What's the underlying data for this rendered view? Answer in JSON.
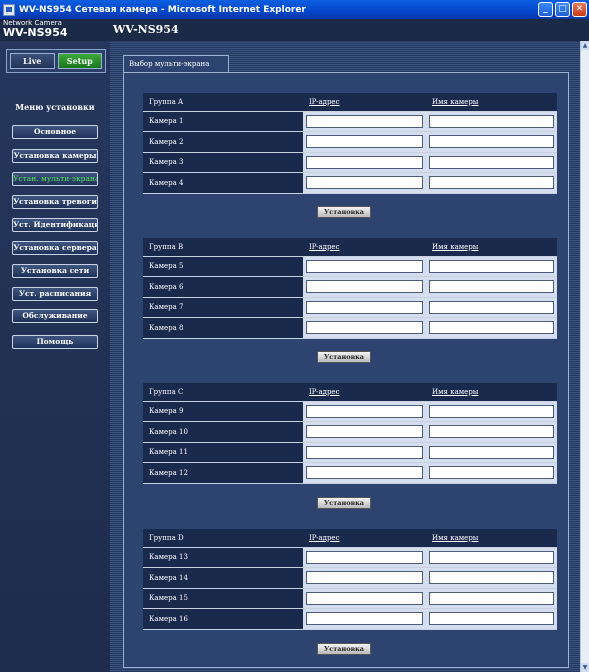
{
  "window": {
    "title": "WV-NS954 Сетевая камера - Microsoft Internet Explorer"
  },
  "header": {
    "brand_small": "Network Camera",
    "brand_model": "WV-NS954",
    "model": "WV-NS954"
  },
  "mode": {
    "live": "Live",
    "setup": "Setup"
  },
  "sidebar": {
    "title": "Меню установки",
    "items": [
      {
        "label": "Основное"
      },
      {
        "label": "Установка камеры"
      },
      {
        "label": "Устан. мульти-экрана"
      },
      {
        "label": "Установка тревоги"
      },
      {
        "label": "Уст. Идентификации"
      },
      {
        "label": "Установка сервера"
      },
      {
        "label": "Установка сети"
      },
      {
        "label": "Уст. расписания"
      },
      {
        "label": "Обслуживание"
      },
      {
        "label": "Помощь"
      }
    ]
  },
  "tab": {
    "label": "Выбор мульти-экрана"
  },
  "columns": {
    "ip": "IP-адрес",
    "name": "Имя камеры"
  },
  "set_button": "Установка",
  "groups": [
    {
      "title": "Группа A",
      "cameras": [
        "Камера 1",
        "Камера 2",
        "Камера 3",
        "Камера 4"
      ]
    },
    {
      "title": "Группа B",
      "cameras": [
        "Камера 5",
        "Камера 6",
        "Камера 7",
        "Камера 8"
      ]
    },
    {
      "title": "Группа C",
      "cameras": [
        "Камера 9",
        "Камера 10",
        "Камера 11",
        "Камера 12"
      ]
    },
    {
      "title": "Группа D",
      "cameras": [
        "Камера 13",
        "Камера 14",
        "Камера 15",
        "Камера 16"
      ]
    }
  ],
  "colors": {
    "setup_active": "#17761c",
    "active_item_text": "#55e05a",
    "panel": "#2d4370"
  }
}
